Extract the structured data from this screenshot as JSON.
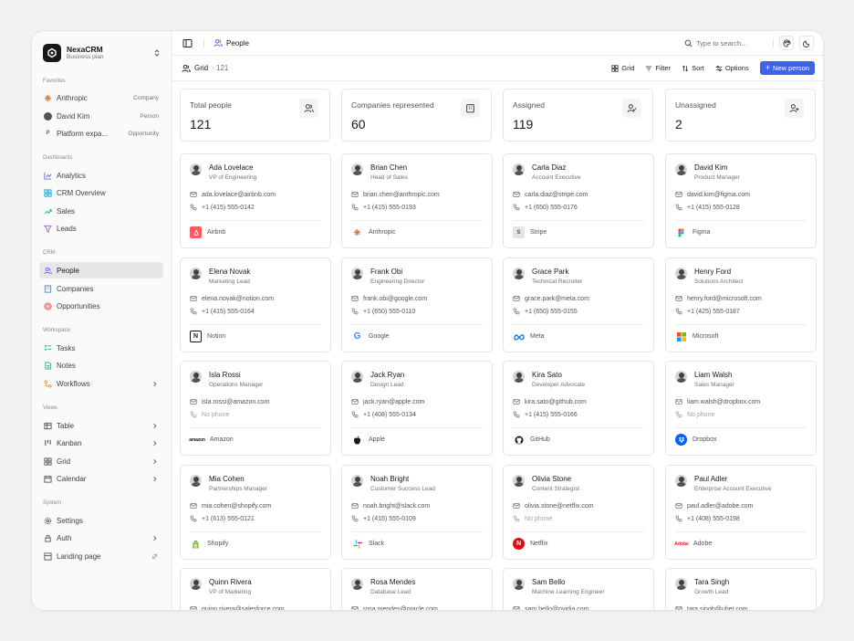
{
  "app": {
    "name": "NexaCRM",
    "plan": "Business plan"
  },
  "sidebar": {
    "favorites_label": "Favorites",
    "favorites": [
      {
        "label": "Anthropic",
        "tag": "Company"
      },
      {
        "label": "David Kim",
        "tag": "Person"
      },
      {
        "label": "Platform expa...",
        "tag": "Opportunity"
      }
    ],
    "dashboards_label": "Dashboards",
    "dashboards": [
      "Analytics",
      "CRM Overview",
      "Sales",
      "Leads"
    ],
    "crm_label": "CRM",
    "crm": [
      "People",
      "Companies",
      "Opportunities"
    ],
    "workspace_label": "Workspace",
    "workspace": [
      "Tasks",
      "Notes",
      "Workflows"
    ],
    "views_label": "Views",
    "views": [
      "Table",
      "Kanban",
      "Grid",
      "Calendar"
    ],
    "system_label": "System",
    "system": [
      "Settings",
      "Auth",
      "Landing page"
    ]
  },
  "topbar": {
    "title": "People",
    "search_placeholder": "Type to search..."
  },
  "subbar": {
    "view": "Grid",
    "count": "· 121",
    "grid_label": "Grid",
    "filter_label": "Filter",
    "sort_label": "Sort",
    "options_label": "Options",
    "new_label": "New person"
  },
  "stats": [
    {
      "label": "Total people",
      "value": "121"
    },
    {
      "label": "Companies represented",
      "value": "60"
    },
    {
      "label": "Assigned",
      "value": "119"
    },
    {
      "label": "Unassigned",
      "value": "2"
    }
  ],
  "people": [
    {
      "name": "Ada Lovelace",
      "title": "VP of Engineering",
      "email": "ada.lovelace@airbnb.com",
      "phone": "+1 (415) 555-0142",
      "company": "Airbnb",
      "logo": "airbnb"
    },
    {
      "name": "Brian Chen",
      "title": "Head of Sales",
      "email": "brian.chen@anthropic.com",
      "phone": "+1 (415) 555-0193",
      "company": "Anthropic",
      "logo": "anthropic"
    },
    {
      "name": "Carla Diaz",
      "title": "Account Executive",
      "email": "carla.diaz@stripe.com",
      "phone": "+1 (650) 555-0176",
      "company": "Stripe",
      "logo": "stripe"
    },
    {
      "name": "David Kim",
      "title": "Product Manager",
      "email": "david.kim@figma.com",
      "phone": "+1 (415) 555-0128",
      "company": "Figma",
      "logo": "figma"
    },
    {
      "name": "Elena Novak",
      "title": "Marketing Lead",
      "email": "elena.novak@notion.com",
      "phone": "+1 (415) 555-0164",
      "company": "Notion",
      "logo": "notion"
    },
    {
      "name": "Frank Obi",
      "title": "Engineering Director",
      "email": "frank.obi@google.com",
      "phone": "+1 (650) 555-0110",
      "company": "Google",
      "logo": "google"
    },
    {
      "name": "Grace Park",
      "title": "Technical Recruiter",
      "email": "grace.park@meta.com",
      "phone": "+1 (650) 555-0155",
      "company": "Meta",
      "logo": "meta"
    },
    {
      "name": "Henry Ford",
      "title": "Solutions Architect",
      "email": "henry.ford@microsoft.com",
      "phone": "+1 (425) 555-0187",
      "company": "Microsoft",
      "logo": "microsoft"
    },
    {
      "name": "Isla Rossi",
      "title": "Operations Manager",
      "email": "isla.rossi@amazon.com",
      "phone": "No phone",
      "company": "Amazon",
      "logo": "amazon"
    },
    {
      "name": "Jack Ryan",
      "title": "Design Lead",
      "email": "jack.ryan@apple.com",
      "phone": "+1 (408) 555-0134",
      "company": "Apple",
      "logo": "apple"
    },
    {
      "name": "Kira Sato",
      "title": "Developer Advocate",
      "email": "kira.sato@github.com",
      "phone": "+1 (415) 555-0166",
      "company": "GitHub",
      "logo": "github"
    },
    {
      "name": "Liam Walsh",
      "title": "Sales Manager",
      "email": "liam.walsh@dropbox.com",
      "phone": "No phone",
      "company": "Dropbox",
      "logo": "dropbox"
    },
    {
      "name": "Mia Cohen",
      "title": "Partnerships Manager",
      "email": "mia.cohen@shopify.com",
      "phone": "+1 (613) 555-0121",
      "company": "Shopify",
      "logo": "shopify"
    },
    {
      "name": "Noah Bright",
      "title": "Customer Success Lead",
      "email": "noah.bright@slack.com",
      "phone": "+1 (415) 555-0109",
      "company": "Slack",
      "logo": "slack"
    },
    {
      "name": "Olivia Stone",
      "title": "Content Strategist",
      "email": "olivia.stone@netflix.com",
      "phone": "No phone",
      "company": "Netflix",
      "logo": "netflix"
    },
    {
      "name": "Paul Adler",
      "title": "Enterprise Account Executive",
      "email": "paul.adler@adobe.com",
      "phone": "+1 (408) 555-0198",
      "company": "Adobe",
      "logo": "adobe"
    },
    {
      "name": "Quinn Rivera",
      "title": "VP of Marketing",
      "email": "quinn.rivera@salesforce.com",
      "phone": "",
      "company": "",
      "logo": ""
    },
    {
      "name": "Rosa Mendes",
      "title": "Database Lead",
      "email": "rosa.mendes@oracle.com",
      "phone": "",
      "company": "",
      "logo": ""
    },
    {
      "name": "Sam Bello",
      "title": "Machine Learning Engineer",
      "email": "sam.bello@nvidia.com",
      "phone": "",
      "company": "",
      "logo": ""
    },
    {
      "name": "Tara Singh",
      "title": "Growth Lead",
      "email": "tara.singh@uber.com",
      "phone": "",
      "company": "",
      "logo": ""
    }
  ],
  "colors": {
    "accent": "#3f63e6",
    "muted": "#a1a1aa"
  }
}
